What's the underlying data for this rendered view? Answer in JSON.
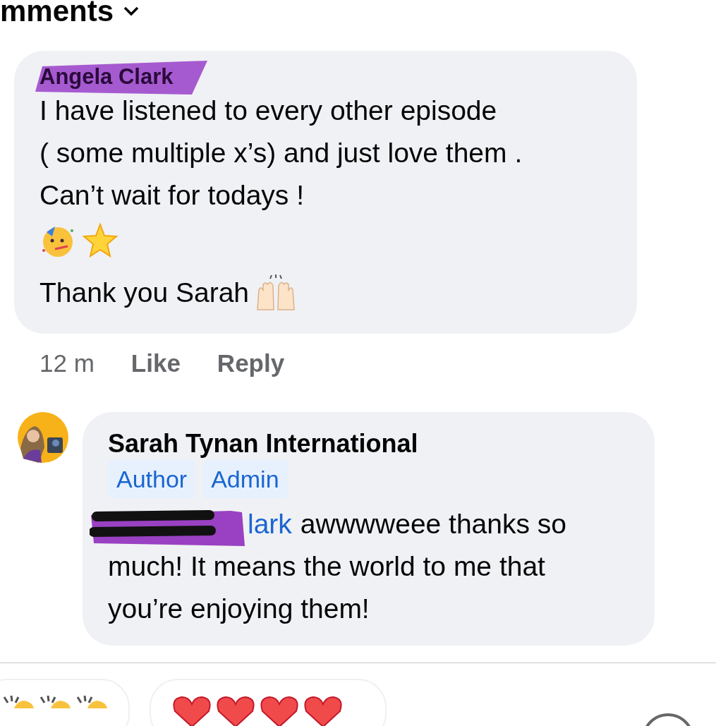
{
  "header": {
    "title": "mments"
  },
  "comment": {
    "author": "Angela Clark",
    "lines": [
      "I have listened to every other episode",
      "( some multiple x’s) and just love them .",
      "Can’t wait for todays !"
    ],
    "closing": "Thank you Sarah",
    "time": "12 m",
    "actions": [
      "Like",
      "Reply"
    ]
  },
  "reply": {
    "author": "Sarah Tynan International",
    "badges": [
      "Author",
      "Admin"
    ],
    "mention": "lark",
    "lines": [
      "awwwweee thanks so",
      "much! It means the world to me that",
      "you’re enjoying them!"
    ]
  },
  "suggestions": [
    {
      "kind": "clap"
    },
    {
      "kind": "hearts"
    }
  ]
}
